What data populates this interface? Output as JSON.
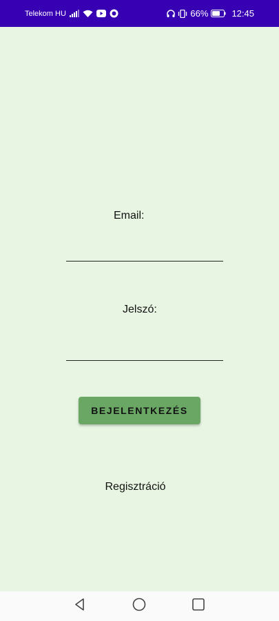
{
  "status_bar": {
    "carrier": "Telekom HU",
    "battery_percent": "66%",
    "time": "12:45",
    "background_color": "#3700b3",
    "icons": [
      "signal-icon",
      "wifi-icon",
      "youtube-icon",
      "app-notification-icon",
      "headphones-icon",
      "vibrate-icon",
      "battery-icon"
    ]
  },
  "form": {
    "email_label": "Email:",
    "email_value": "",
    "password_label": "Jelszó:",
    "password_value": "",
    "login_button": "BEJELENTKEZÉS",
    "register_link": "Regisztráció"
  },
  "theme": {
    "background": "#e8f5e3",
    "button_color": "#6aa765"
  },
  "nav_bar": {
    "icons": [
      "back-icon",
      "home-icon",
      "recent-apps-icon"
    ]
  }
}
